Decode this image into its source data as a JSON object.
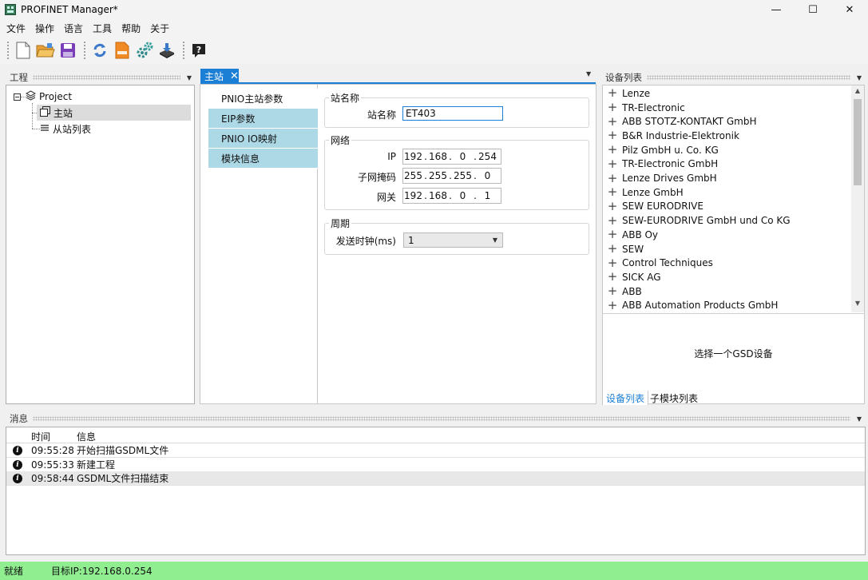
{
  "window": {
    "title": "PROFINET Manager*",
    "minimize": "—",
    "maximize": "☐",
    "close": "✕"
  },
  "menu": [
    "文件",
    "操作",
    "语言",
    "工具",
    "帮助",
    "关于"
  ],
  "toolbar": {
    "buttons": [
      "new-file-icon",
      "open-folder-icon",
      "save-icon",
      "refresh-icon",
      "gsdml-file-icon",
      "settings-gears-icon",
      "download-icon",
      "help-icon"
    ],
    "help_glyph": "?"
  },
  "project_panel": {
    "title": "工程",
    "tree": {
      "root": "Project",
      "children": [
        "主站",
        "从站列表"
      ]
    }
  },
  "doc_tab": {
    "label": "主站",
    "close": "✕"
  },
  "side_tabs": [
    "PNIO主站参数",
    "EIP参数",
    "PNIO IO映射",
    "模块信息"
  ],
  "station_group": {
    "title": "站名称",
    "label": "站名称",
    "value": "ET403"
  },
  "network_group": {
    "title": "网络",
    "ip_label": "IP",
    "ip": [
      "192",
      "168",
      "0",
      "254"
    ],
    "mask_label": "子网掩码",
    "mask": [
      "255",
      "255",
      "255",
      "0"
    ],
    "gateway_label": "网关",
    "gateway": [
      "192",
      "168",
      "0",
      "1"
    ],
    "separator": "."
  },
  "cycle_group": {
    "title": "周期",
    "label": "发送时钟(ms)",
    "value": "1"
  },
  "device_panel": {
    "title": "设备列表",
    "devices": [
      "Lenze",
      "TR-Electronic",
      "ABB STOTZ-KONTAKT GmbH",
      "B&R Industrie-Elektronik",
      "Pilz GmbH u. Co. KG",
      "TR-Electronic GmbH",
      "Lenze Drives GmbH",
      "Lenze GmbH",
      "SEW EURODRIVE",
      "SEW-EURODRIVE GmbH und Co KG",
      "ABB Oy",
      "SEW",
      "Control Techniques",
      "SICK AG",
      "ABB",
      "ABB Automation Products GmbH"
    ],
    "expand_glyph": "+",
    "placeholder": "选择一个GSD设备",
    "tabs": [
      "设备列表",
      "子模块列表"
    ]
  },
  "messages_panel": {
    "title": "消息",
    "columns": [
      "时间",
      "信息"
    ],
    "rows": [
      {
        "time": "09:55:28",
        "text": "开始扫描GSDML文件"
      },
      {
        "time": "09:55:33",
        "text": "新建工程"
      },
      {
        "time": "09:58:44",
        "text": "GSDML文件扫描结束"
      }
    ],
    "info_glyph": "i"
  },
  "status": {
    "state": "就绪",
    "target_ip": "目标IP:192.168.0.254",
    "color": "#90ee90"
  },
  "colors": {
    "accent": "#1c7fd6",
    "side_tab": "#add8e6"
  }
}
